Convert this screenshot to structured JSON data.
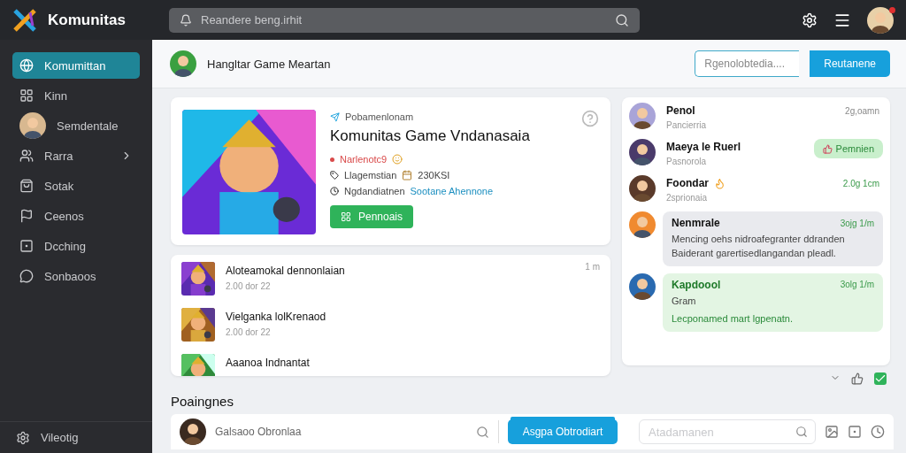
{
  "topbar": {
    "app_name": "Komunitas",
    "search": {
      "placeholder": "Reandere beng.irhit"
    },
    "notification": true
  },
  "sidebar": {
    "items": [
      {
        "label": "Komumittan",
        "selected": true,
        "submenu": false
      },
      {
        "label": "Kinn",
        "selected": false,
        "submenu": false
      },
      {
        "label": "Semdentale",
        "selected": false,
        "submenu": false
      },
      {
        "label": "Rarra",
        "selected": false,
        "submenu": true
      },
      {
        "label": "Sotak",
        "selected": false,
        "submenu": false
      },
      {
        "label": "Ceenos",
        "selected": false,
        "submenu": false
      },
      {
        "label": "Dcching",
        "selected": false,
        "submenu": false
      },
      {
        "label": "Sonbaoos",
        "selected": false,
        "submenu": false
      }
    ],
    "footer": "Vileotig"
  },
  "header": {
    "title": "Hangltar Game Meartan",
    "search": {
      "placeholder": "Rgenolobtedia...."
    },
    "button": "Reutanene"
  },
  "featured": {
    "tag": "Pobamenlonam",
    "title": "Komunitas Game Vndanasaia",
    "stats": [
      {
        "kind": "alert",
        "label": "Narlenotc9"
      },
      {
        "kind": "count",
        "label": "Llagemstian",
        "value": "230KSI"
      },
      {
        "kind": "link",
        "label": "Ngdandiatnen",
        "value": "Sootane Ahennone"
      }
    ],
    "button": "Pennoais"
  },
  "posts": [
    {
      "title": "Aloteamokal dennonlaian",
      "date": "2.00 dor 22",
      "time": "1 m"
    },
    {
      "title": "Vielganka lolKrenaod",
      "date": "2.00 dor 22"
    },
    {
      "title": "Aaanoa Indnantat"
    }
  ],
  "messages": [
    {
      "kind": "contact",
      "name": "Penol",
      "sub": "Pancierria",
      "time": "2g,oamn",
      "hot": false
    },
    {
      "kind": "action",
      "name": "Maeya le Ruerl",
      "sub": "Pasnorola",
      "button": "Pemnien",
      "hot": false
    },
    {
      "kind": "contact",
      "name": "Foondar",
      "sub": "2sprionaia",
      "time": "2.0g 1cm",
      "hot": true
    },
    {
      "kind": "bubble",
      "name": "Nenmrale",
      "text": "Mencing oehs nidroafegranter ddranden Baiderant garertisedlangandan pleadl.",
      "time": "3ojg 1/m",
      "color": "#e9eaee"
    },
    {
      "kind": "bubble",
      "name": "Kapdoool",
      "sub": "Gram",
      "text": "Lecponamed mart lgpenatn.",
      "time": "3olg 1/m",
      "color": "#e3f5e3"
    }
  ],
  "section_title": "Poaingnes",
  "composer": {
    "name": "Galsaoo Obronlaa",
    "button": "Asgpa Obtrodiart",
    "search": {
      "placeholder": "Atadamanen"
    }
  }
}
